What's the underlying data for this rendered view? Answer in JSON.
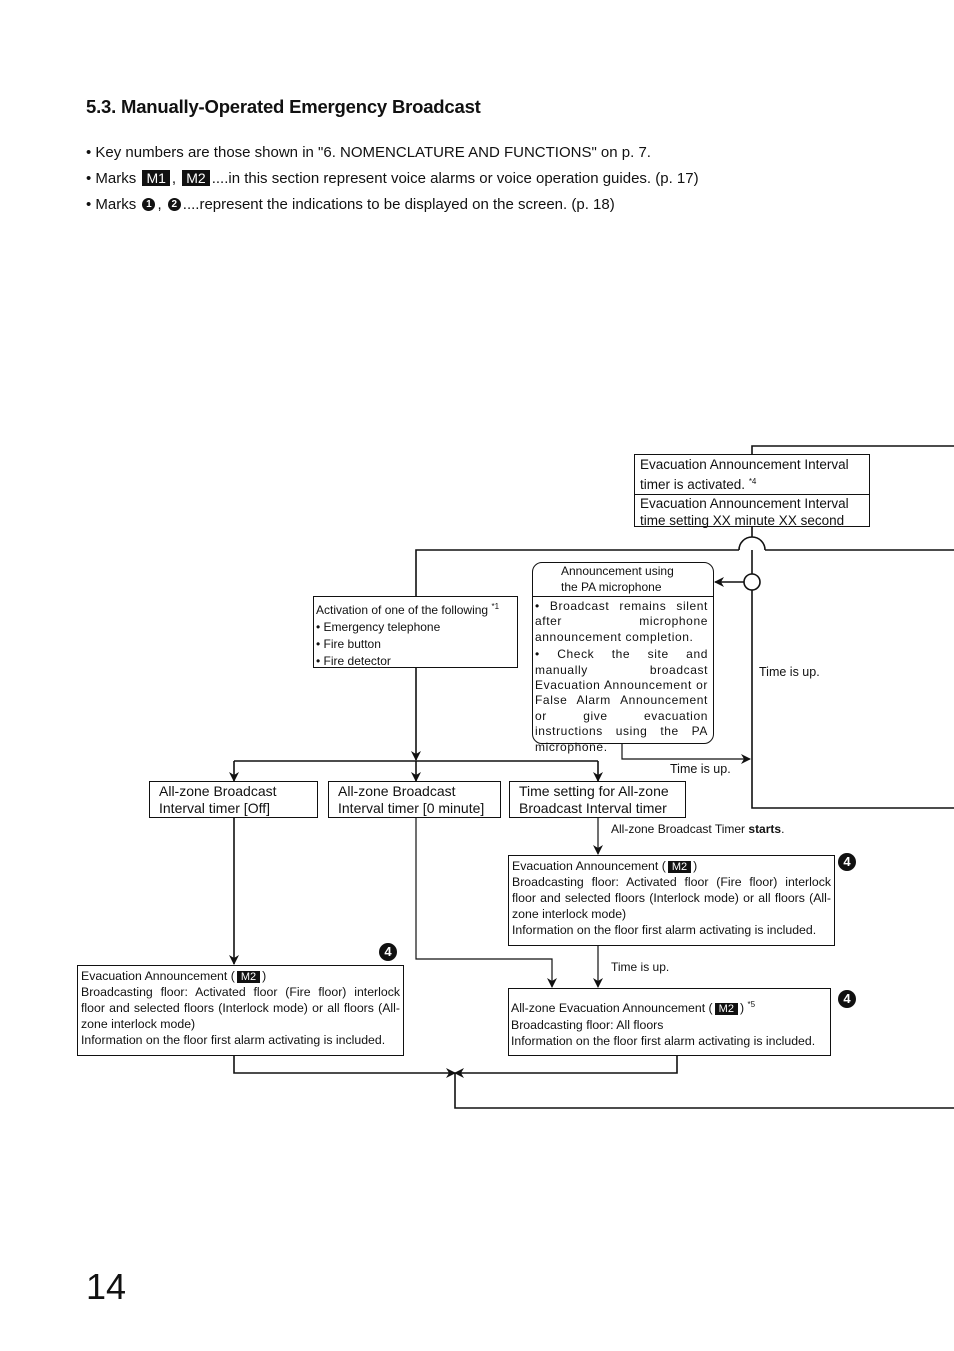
{
  "section": {
    "title": "5.3. Manually-Operated Emergency Broadcast",
    "bullets": {
      "b1": "• Key numbers are those shown in \"6. NOMENCLATURE AND FUNCTIONS\" on p. 7.",
      "b2_prefix": "• Marks",
      "b2_mark1": "M1",
      "b2_mark2": "M2",
      "b2_suffix": "....in this section represent voice alarms or voice operation guides. (p. 17)",
      "b3_prefix": "• Marks",
      "b3_circ1": "1",
      "b3_circ2": "2",
      "b3_suffix": "....represent the indications to be displayed on the screen. (p. 18)",
      "comma": ","
    }
  },
  "flow": {
    "interval_timer": {
      "line1": "Evacuation Announcement Interval",
      "line2": "timer is activated.",
      "note": "*4",
      "line3": "Evacuation Announcement Interval",
      "line4": "time setting XX minute XX second"
    },
    "activation": {
      "heading": "Activation of one of the following",
      "note": "*1",
      "items": [
        "• Emergency telephone",
        "• Fire button",
        "• Fire detector"
      ]
    },
    "pa_mic": {
      "heading1": "Announcement using",
      "heading2": "the PA microphone",
      "item1": "• Broadcast remains silent after microphone announcement completion.",
      "item2": "• Check the site and manually broadcast Evacuation Announcement or False Alarm Announcement or give evacuation instructions using the PA microphone."
    },
    "timer_off": {
      "line1": "All-zone Broadcast",
      "line2": "Interval timer [Off]"
    },
    "timer_zero": {
      "line1": "All-zone Broadcast",
      "line2": "Interval timer [0 minute]"
    },
    "timer_setting": {
      "line1": "Time setting for All-zone",
      "line2": "Broadcast Interval timer"
    },
    "labels": {
      "time_up_right": "Time is up.",
      "time_up_mic": "Time is up.",
      "timer_starts_prefix": "All-zone Broadcast Timer ",
      "timer_starts_bold": "starts",
      "timer_starts_suffix": ".",
      "time_up_lower": "Time is up."
    },
    "evac_right": {
      "title_prefix": "Evacuation Announcement (",
      "mark": "M2",
      "title_suffix": ")",
      "body": "Broadcasting floor: Activated floor (Fire floor) interlock floor and selected floors (Interlock mode) or all floors (All-zone interlock mode)",
      "info": "Information on the floor first alarm activating is included.",
      "screen_indicator": "4"
    },
    "evac_left": {
      "title_prefix": "Evacuation Announcement (",
      "mark": "M2",
      "title_suffix": ")",
      "body": "Broadcasting floor: Activated floor (Fire floor) interlock floor and selected floors (Interlock mode) or all floors (All-zone interlock mode)",
      "info": "Information on the floor first alarm activating is included.",
      "screen_indicator": "4"
    },
    "allzone_evac": {
      "title_prefix": "All-zone Evacuation Announcement (",
      "mark": "M2",
      "title_suffix": ")",
      "note": "*5",
      "body": "Broadcasting floor: All floors",
      "info": "Information on the floor first alarm activating is included.",
      "screen_indicator": "4"
    }
  },
  "page_number": "14"
}
